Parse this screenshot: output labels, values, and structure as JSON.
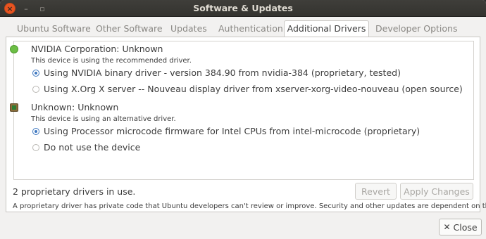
{
  "window": {
    "title": "Software & Updates",
    "controls": {
      "close": "×",
      "minimize": "–",
      "maximize": "▫"
    }
  },
  "tabs": [
    {
      "label": "Ubuntu Software",
      "active": false
    },
    {
      "label": "Other Software",
      "active": false
    },
    {
      "label": "Updates",
      "active": false
    },
    {
      "label": "Authentication",
      "active": false
    },
    {
      "label": "Additional Drivers",
      "active": true
    },
    {
      "label": "Developer Options",
      "active": false
    }
  ],
  "devices": [
    {
      "icon": "gpu-status-icon",
      "name": "NVIDIA Corporation: Unknown",
      "note": "This device is using the recommended driver.",
      "options": [
        {
          "label": "Using NVIDIA binary driver - version 384.90 from nvidia-384 (proprietary, tested)",
          "selected": true
        },
        {
          "label": "Using X.Org X server -- Nouveau display driver from xserver-xorg-video-nouveau (open source)",
          "selected": false
        }
      ]
    },
    {
      "icon": "cpu-chip-icon",
      "name": "Unknown: Unknown",
      "note": "This device is using an alternative driver.",
      "options": [
        {
          "label": "Using Processor microcode firmware for Intel CPUs from intel-microcode (proprietary)",
          "selected": true
        },
        {
          "label": "Do not use the device",
          "selected": false
        }
      ]
    }
  ],
  "status": "2 proprietary drivers in use.",
  "buttons": {
    "revert": "Revert",
    "apply": "Apply Changes",
    "close": "Close",
    "close_icon": "✕"
  },
  "footnote": "A proprietary driver has private code that Ubuntu developers can't review or improve. Security and other updates are dependent on the driver vendor."
}
